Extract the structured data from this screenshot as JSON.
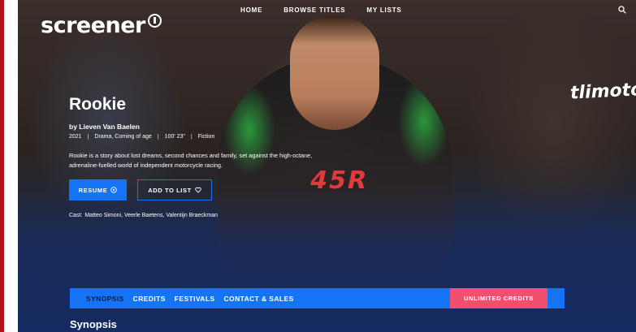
{
  "brand": {
    "name": "screener"
  },
  "nav": {
    "items": [
      "HOME",
      "BROWSE TITLES",
      "MY LISTS"
    ]
  },
  "hero": {
    "title": "Rookie",
    "director": "by Lieven Van Baelen",
    "meta": {
      "year": "2021",
      "genres": "Drama, Coming of age",
      "runtime": "100' 23\"",
      "category": "Fiction"
    },
    "synopsis": "Rookie is a story about lost dreams, second chances and family, set against the high-octane, adrenaline-fuelled world of independent motorcycle racing.",
    "resume_label": "RESUME",
    "add_label": "ADD TO LIST",
    "cast_label": "Cast:",
    "cast": "Matteo Simoni, Veerle Baetens, Valentijn Braeckman"
  },
  "background": {
    "race_number": "45R",
    "sponsor": "tlimotos"
  },
  "tabs": [
    "SYNOPSIS",
    "CREDITS",
    "FESTIVALS",
    "CONTACT & SALES"
  ],
  "unlimited_label": "UNLIMITED CREDITS",
  "section": {
    "heading": "Synopsis"
  },
  "colors": {
    "accent": "#1574f5",
    "pink": "#f0506e",
    "navy": "#152a60"
  }
}
